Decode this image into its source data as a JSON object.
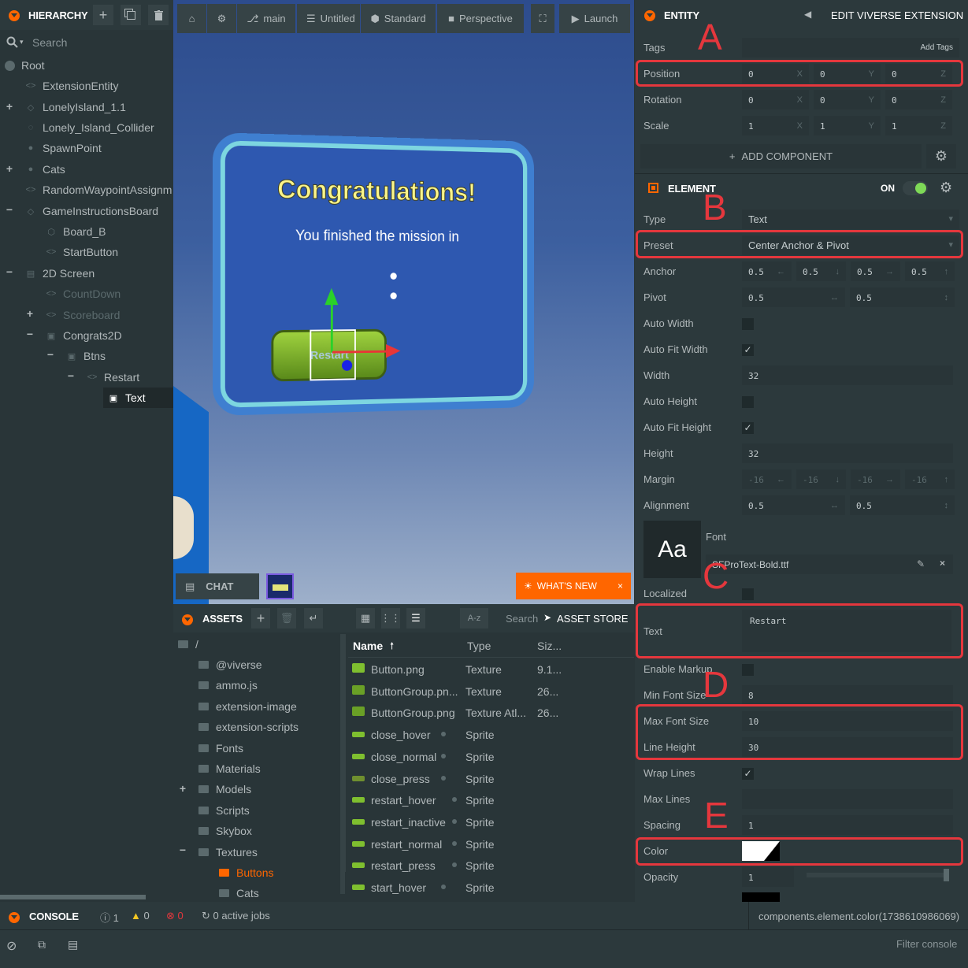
{
  "hierarchy": {
    "title": "HIERARCHY",
    "search_placeholder": "Search",
    "items": [
      {
        "label": "Root"
      },
      {
        "label": "ExtensionEntity"
      },
      {
        "label": "LonelyIsland_1.1"
      },
      {
        "label": "Lonely_Island_Collider"
      },
      {
        "label": "SpawnPoint"
      },
      {
        "label": "Cats"
      },
      {
        "label": "RandomWaypointAssignm"
      },
      {
        "label": "GameInstructionsBoard"
      },
      {
        "label": "Board_B"
      },
      {
        "label": "StartButton"
      },
      {
        "label": "2D Screen"
      },
      {
        "label": "CountDown"
      },
      {
        "label": "Scoreboard"
      },
      {
        "label": "Congrats2D"
      },
      {
        "label": "Btns"
      },
      {
        "label": "Restart"
      },
      {
        "label": "Text"
      }
    ]
  },
  "toolbar": {
    "branch": "main",
    "scene": "Untitled",
    "render": "Standard",
    "camera": "Perspective",
    "launch": "Launch"
  },
  "viewport": {
    "board_title": "Congratulations!",
    "board_subtitle": "You finished the mission in",
    "button_text": "Restart",
    "chat_label": "CHAT",
    "whats_new": "WHAT'S NEW"
  },
  "inspector": {
    "title": "ENTITY",
    "edit_link": "EDIT VIVERSE EXTENSION",
    "tags_label": "Tags",
    "tags_add": "Add Tags",
    "position": {
      "label": "Position",
      "x": "0",
      "y": "0",
      "z": "0"
    },
    "rotation": {
      "label": "Rotation",
      "x": "0",
      "y": "0",
      "z": "0"
    },
    "scale": {
      "label": "Scale",
      "x": "1",
      "y": "1",
      "z": "1"
    },
    "add_component": "ADD COMPONENT",
    "element_title": "ELEMENT",
    "element_on": "ON",
    "type": {
      "label": "Type",
      "value": "Text"
    },
    "preset": {
      "label": "Preset",
      "value": "Center Anchor & Pivot"
    },
    "anchor": {
      "label": "Anchor",
      "values": [
        "0.5",
        "0.5",
        "0.5",
        "0.5"
      ]
    },
    "pivot": {
      "label": "Pivot",
      "values": [
        "0.5",
        "0.5"
      ]
    },
    "auto_width": {
      "label": "Auto Width",
      "checked": false
    },
    "auto_fit_width": {
      "label": "Auto Fit Width",
      "checked": true
    },
    "width": {
      "label": "Width",
      "value": "32"
    },
    "auto_height": {
      "label": "Auto Height",
      "checked": false
    },
    "auto_fit_height": {
      "label": "Auto Fit Height",
      "checked": true
    },
    "height": {
      "label": "Height",
      "value": "32"
    },
    "margin": {
      "label": "Margin",
      "values": [
        "-16",
        "-16",
        "-16",
        "-16"
      ]
    },
    "alignment": {
      "label": "Alignment",
      "values": [
        "0.5",
        "0.5"
      ]
    },
    "font": {
      "label": "Font",
      "preview": "Aa",
      "file": "SFProText-Bold.ttf"
    },
    "localized": {
      "label": "Localized",
      "checked": false
    },
    "text": {
      "label": "Text",
      "value": "Restart"
    },
    "enable_markup": {
      "label": "Enable Markup",
      "checked": false
    },
    "min_font_size": {
      "label": "Min Font Size",
      "value": "8"
    },
    "max_font_size": {
      "label": "Max Font Size",
      "value": "10"
    },
    "line_height": {
      "label": "Line Height",
      "value": "30"
    },
    "wrap_lines": {
      "label": "Wrap Lines",
      "checked": true
    },
    "max_lines": {
      "label": "Max Lines",
      "value": ""
    },
    "spacing": {
      "label": "Spacing",
      "value": "1"
    },
    "color": {
      "label": "Color",
      "value": "#ffffff"
    },
    "opacity": {
      "label": "Opacity",
      "value": "1"
    },
    "annotations": [
      "A",
      "B",
      "C",
      "D",
      "E"
    ]
  },
  "assets": {
    "title": "ASSETS",
    "path": "/",
    "search_placeholder": "Search",
    "store": "ASSET STORE",
    "sort": "A-z",
    "folders": [
      "@viverse",
      "ammo.js",
      "extension-image",
      "extension-scripts",
      "Fonts",
      "Materials",
      "Models",
      "Scripts",
      "Skybox",
      "Textures",
      "Buttons",
      "Cats"
    ],
    "columns": {
      "name": "Name",
      "type": "Type",
      "size": "Siz..."
    },
    "rows": [
      {
        "name": "Button.png",
        "type": "Texture",
        "size": "9.1..."
      },
      {
        "name": "ButtonGroup.pn...",
        "type": "Texture",
        "size": "26..."
      },
      {
        "name": "ButtonGroup.png",
        "type": "Texture Atl...",
        "size": "26..."
      },
      {
        "name": "close_hover",
        "type": "Sprite",
        "size": ""
      },
      {
        "name": "close_normal",
        "type": "Sprite",
        "size": ""
      },
      {
        "name": "close_press",
        "type": "Sprite",
        "size": ""
      },
      {
        "name": "restart_hover",
        "type": "Sprite",
        "size": ""
      },
      {
        "name": "restart_inactive",
        "type": "Sprite",
        "size": ""
      },
      {
        "name": "restart_normal",
        "type": "Sprite",
        "size": ""
      },
      {
        "name": "restart_press",
        "type": "Sprite",
        "size": ""
      },
      {
        "name": "start_hover",
        "type": "Sprite",
        "size": ""
      }
    ]
  },
  "console": {
    "title": "CONSOLE",
    "info_count": "1",
    "warn_count": "0",
    "error_count": "0",
    "jobs": "0 active jobs",
    "status": "components.element.color(1738610986069)",
    "filter_placeholder": "Filter console"
  },
  "colors": {
    "accent": "#ff6600",
    "annotation": "#e5373d",
    "toggle_on": "#7ed957"
  }
}
